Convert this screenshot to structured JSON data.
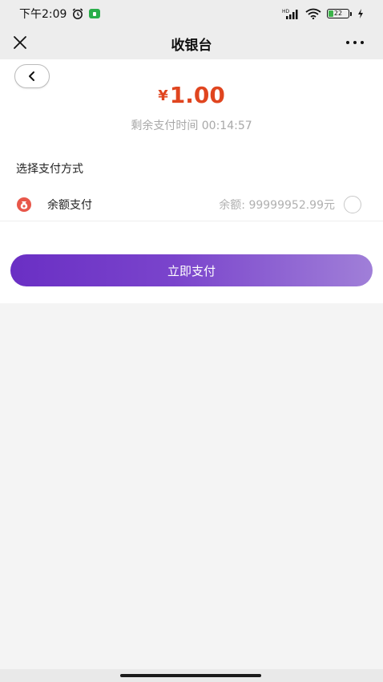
{
  "status_bar": {
    "time": "下午2:09",
    "network_label": "HD",
    "battery": "22"
  },
  "nav": {
    "title": "收银台"
  },
  "payment": {
    "currency_symbol": "¥",
    "amount": "1.00",
    "countdown": "剩余支付时间 00:14:57",
    "section_title": "选择支付方式",
    "method_label": "余额支付",
    "balance": "余额: 99999952.99元",
    "pay_button_label": "立即支付"
  },
  "colors": {
    "accent_red": "#e0451f",
    "button_start": "#6a2fc4",
    "button_end": "#a07fd8"
  }
}
